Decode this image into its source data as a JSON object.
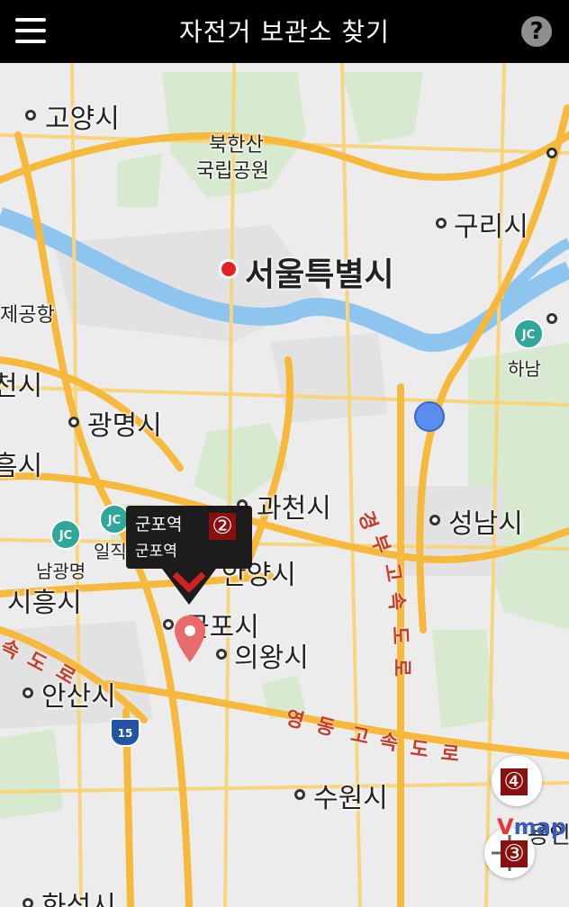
{
  "header": {
    "title": "자전거 보관소 찾기"
  },
  "icons": {
    "menu": "hamburger-menu-icon",
    "help": "question-circle-icon",
    "pin": "map-pin-icon",
    "location": "my-location-icon",
    "compass": "compass-icon"
  },
  "colors": {
    "header_bg": "#000000",
    "river": "#8ec5ef",
    "highway": "#f6b93b",
    "road": "#f7d57e",
    "pin": "#e86a6a",
    "current_location": "#5b8def",
    "badge": "#8a1010"
  },
  "map": {
    "labels": {
      "goyang": "고양시",
      "bukhansan_1": "북한산",
      "bukhansan_2": "국립공원",
      "seoul": "서울특별시",
      "guri": "구리시",
      "airport": "제공항",
      "hanam": "하남",
      "gwangmyeong": "광명시",
      "gwacheon": "과천시",
      "seongnam": "성남시",
      "namgwangmyeong": "남광명",
      "ilji": "일직",
      "siheung": "시흥시",
      "anyang": "안양시",
      "gunpo": "군포시",
      "uiwang": "의왕시",
      "ansan": "안산시",
      "suwon": "수원시",
      "hwaseong": "화성시",
      "yongin": "용인",
      "cheon": "천시",
      "eum": "흠시"
    },
    "roads": {
      "gyeongbu_1": "경",
      "gyeongbu_2": "부",
      "gyeongbu_3": "고",
      "gyeongbu_4": "속",
      "gyeongbu_5": "도",
      "gyeongbu_6": "로",
      "yeongdong_1": "영",
      "yeongdong_2": "동",
      "yeongdong_3": "고",
      "yeongdong_4": "속",
      "yeongdong_5": "도",
      "yeongdong_6": "로",
      "west_1": "속",
      "west_2": "도",
      "west_3": "로",
      "route_15": "15"
    },
    "jc_label": "JC",
    "popup": {
      "name": "군포역",
      "subtitle": "군포역",
      "badge": "②"
    },
    "controls": {
      "badge_4": "④",
      "badge_3": "③"
    },
    "provider": {
      "v": "V",
      "map": "map"
    }
  }
}
